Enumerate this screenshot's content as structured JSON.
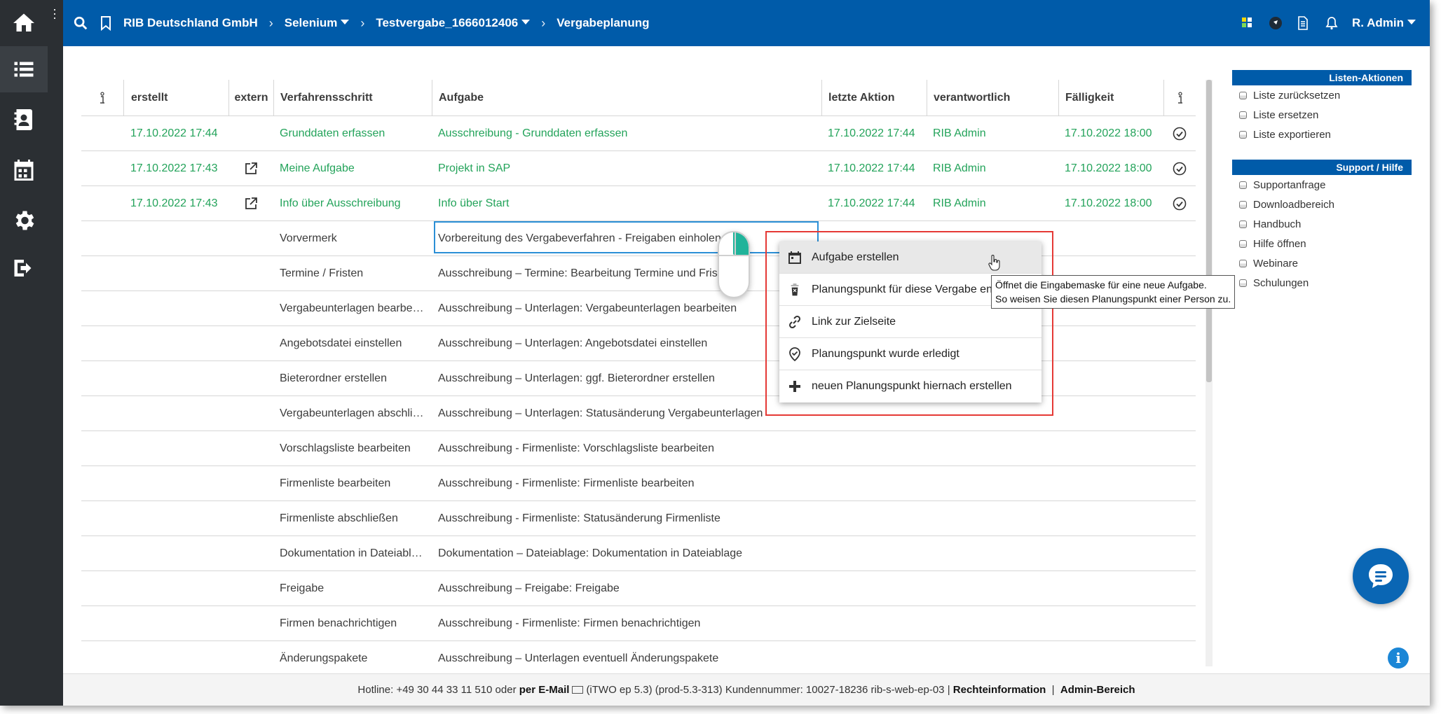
{
  "header": {
    "company": "RIB Deutschland GmbH",
    "crumbs": [
      "Selenium",
      "Testvergabe_1666012406",
      "Vergabeplanung"
    ],
    "user": "R. Admin"
  },
  "table": {
    "columns": {
      "erstellt": "erstellt",
      "extern": "extern",
      "schritt": "Verfahrensschritt",
      "aufgabe": "Aufgabe",
      "aktion": "letzte Aktion",
      "verant": "verantwortlich",
      "faellig": "Fälligkeit"
    },
    "rows": [
      {
        "erstellt": "17.10.2022 17:44",
        "extern": false,
        "schritt": "Grunddaten erfassen",
        "aufgabe": "Ausschreibung - Grunddaten erfassen",
        "aktion": "17.10.2022 17:44",
        "verant": "RIB Admin",
        "faellig": "17.10.2022 18:00",
        "done": true
      },
      {
        "erstellt": "17.10.2022 17:43",
        "extern": true,
        "schritt": "Meine Aufgabe",
        "aufgabe": "Projekt in SAP",
        "aktion": "17.10.2022 17:44",
        "verant": "RIB Admin",
        "faellig": "17.10.2022 18:00",
        "done": true
      },
      {
        "erstellt": "17.10.2022 17:43",
        "extern": true,
        "schritt": "Info über Ausschreibung",
        "aufgabe": "Info über Start",
        "aktion": "17.10.2022 17:44",
        "verant": "RIB Admin",
        "faellig": "17.10.2022 18:00",
        "done": true
      },
      {
        "erstellt": "",
        "extern": false,
        "schritt": "Vorvermerk",
        "aufgabe": "Vorbereitung des Vergabeverfahren - Freigaben einholen",
        "aktion": "",
        "verant": "",
        "faellig": "",
        "done": false
      },
      {
        "erstellt": "",
        "extern": false,
        "schritt": "Termine / Fristen",
        "aufgabe": "Ausschreibung – Termine: Bearbeitung Termine und Fristen",
        "aktion": "",
        "verant": "",
        "faellig": "",
        "done": false
      },
      {
        "erstellt": "",
        "extern": false,
        "schritt": "Vergabeunterlagen bearbe…",
        "aufgabe": "Ausschreibung – Unterlagen: Vergabeunterlagen bearbeiten",
        "aktion": "",
        "verant": "",
        "faellig": "",
        "done": false
      },
      {
        "erstellt": "",
        "extern": false,
        "schritt": "Angebotsdatei einstellen",
        "aufgabe": "Ausschreibung – Unterlagen: Angebotsdatei einstellen",
        "aktion": "",
        "verant": "",
        "faellig": "",
        "done": false
      },
      {
        "erstellt": "",
        "extern": false,
        "schritt": "Bieterordner erstellen",
        "aufgabe": "Ausschreibung – Unterlagen: ggf. Bieterordner erstellen",
        "aktion": "",
        "verant": "",
        "faellig": "",
        "done": false
      },
      {
        "erstellt": "",
        "extern": false,
        "schritt": "Vergabeunterlagen abschli…",
        "aufgabe": "Ausschreibung – Unterlagen: Statusänderung Vergabeunterlagen",
        "aktion": "",
        "verant": "",
        "faellig": "",
        "done": false
      },
      {
        "erstellt": "",
        "extern": false,
        "schritt": "Vorschlagsliste bearbeiten",
        "aufgabe": "Ausschreibung - Firmenliste: Vorschlagsliste bearbeiten",
        "aktion": "",
        "verant": "",
        "faellig": "",
        "done": false
      },
      {
        "erstellt": "",
        "extern": false,
        "schritt": "Firmenliste bearbeiten",
        "aufgabe": "Ausschreibung - Firmenliste: Firmenliste bearbeiten",
        "aktion": "",
        "verant": "",
        "faellig": "",
        "done": false
      },
      {
        "erstellt": "",
        "extern": false,
        "schritt": "Firmenliste abschließen",
        "aufgabe": "Ausschreibung - Firmenliste: Statusänderung Firmenliste",
        "aktion": "",
        "verant": "",
        "faellig": "",
        "done": false
      },
      {
        "erstellt": "",
        "extern": false,
        "schritt": "Dokumentation in Dateiabl…",
        "aufgabe": "Dokumentation – Dateiablage: Dokumentation in Dateiablage",
        "aktion": "",
        "verant": "",
        "faellig": "",
        "done": false
      },
      {
        "erstellt": "",
        "extern": false,
        "schritt": "Freigabe",
        "aufgabe": "Ausschreibung – Freigabe: Freigabe",
        "aktion": "",
        "verant": "",
        "faellig": "",
        "done": false
      },
      {
        "erstellt": "",
        "extern": false,
        "schritt": "Firmen benachrichtigen",
        "aufgabe": "Ausschreibung - Firmenliste: Firmen benachrichtigen",
        "aktion": "",
        "verant": "",
        "faellig": "",
        "done": false
      },
      {
        "erstellt": "",
        "extern": false,
        "schritt": "Änderungspakete",
        "aufgabe": "Ausschreibung – Unterlagen eventuell Änderungspakete",
        "aktion": "",
        "verant": "",
        "faellig": "",
        "done": false
      }
    ]
  },
  "sidebar": {
    "sections": [
      {
        "title": "Listen-Aktionen",
        "items": [
          "Liste zurücksetzen",
          "Liste ersetzen",
          "Liste exportieren"
        ]
      },
      {
        "title": "Support / Hilfe",
        "items": [
          "Supportanfrage",
          "Downloadbereich",
          "Handbuch",
          "Hilfe öffnen",
          "Webinare",
          "Schulungen"
        ]
      }
    ]
  },
  "context_menu": {
    "items": [
      {
        "label": "Aufgabe erstellen",
        "icon": "calendar-icon"
      },
      {
        "label": "Planungspunkt für diese Vergabe entfernen",
        "icon": "trash-icon"
      },
      {
        "label": "Link zur Zielseite",
        "icon": "link-icon"
      },
      {
        "label": "Planungspunkt wurde erledigt",
        "icon": "check-pin-icon"
      },
      {
        "label": "neuen Planungspunkt hiernach erstellen",
        "icon": "plus-icon"
      }
    ],
    "tooltip": [
      "Öffnet die Eingabemaske für eine neue Aufgabe.",
      "So weisen Sie diesen Planungspunkt einer Person zu."
    ]
  },
  "footer": {
    "hotline": "Hotline: +49 30 44 33 11 510 oder",
    "mail_label": "per E-Mail",
    "version": "(iTWO ep 5.3)  (prod-5.3-313)   Kundennummer: 10027-18236 rib-s-web-ep-03 |",
    "rechte": "Rechteinformation",
    "sep": "|",
    "admin": "Admin-Bereich"
  },
  "colors": {
    "brand": "#005ba9",
    "done_green": "#23a35a",
    "highlight_red": "#e53935",
    "rail": "#2b2f33"
  }
}
